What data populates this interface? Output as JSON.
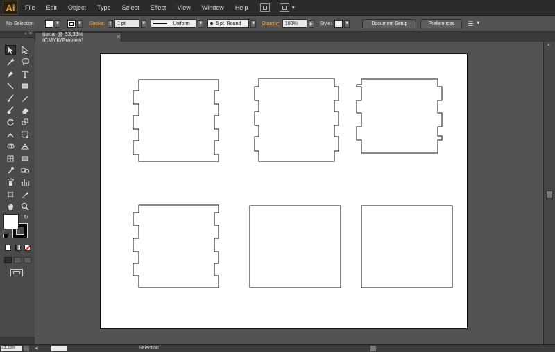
{
  "app": {
    "logo_text": "Ai"
  },
  "menu": {
    "items": [
      "File",
      "Edit",
      "Object",
      "Type",
      "Select",
      "Effect",
      "View",
      "Window",
      "Help"
    ]
  },
  "control_bar": {
    "selection_label": "No Selection",
    "stroke_label": "Stroke:",
    "stroke_weight": "1 pt",
    "stroke_profile": "Uniform",
    "brush_label": "5 pt. Round",
    "opacity_label": "Opacity:",
    "opacity_value": "100%",
    "style_label": "Style:",
    "document_setup_label": "Document Setup",
    "preferences_label": "Preferences",
    "fill_color": "#ffffff"
  },
  "document": {
    "tab_title": "tter.ai @ 33,33% (CMYK/Preview)",
    "close_glyph": "✕"
  },
  "status_bar": {
    "zoom": "33,33%",
    "current_tool": "Selection"
  },
  "tool_icons": [
    "selection-tool-icon",
    "direct-selection-tool-icon",
    "magic-wand-tool-icon",
    "lasso-tool-icon",
    "pen-tool-icon",
    "type-tool-icon",
    "line-segment-tool-icon",
    "rectangle-tool-icon",
    "paintbrush-tool-icon",
    "pencil-tool-icon",
    "blob-brush-tool-icon",
    "eraser-tool-icon",
    "rotate-tool-icon",
    "scale-tool-icon",
    "width-tool-icon",
    "free-transform-tool-icon",
    "shape-builder-tool-icon",
    "perspective-grid-tool-icon",
    "mesh-tool-icon",
    "gradient-tool-icon",
    "eyedropper-tool-icon",
    "blend-tool-icon",
    "symbol-sprayer-tool-icon",
    "column-graph-tool-icon",
    "artboard-tool-icon",
    "slice-tool-icon",
    "hand-tool-icon",
    "zoom-tool-icon"
  ],
  "colors": {
    "accent": "#f0a14a",
    "logo": "#e2a13a",
    "panel": "#535353",
    "artboard": "#ffffff"
  }
}
